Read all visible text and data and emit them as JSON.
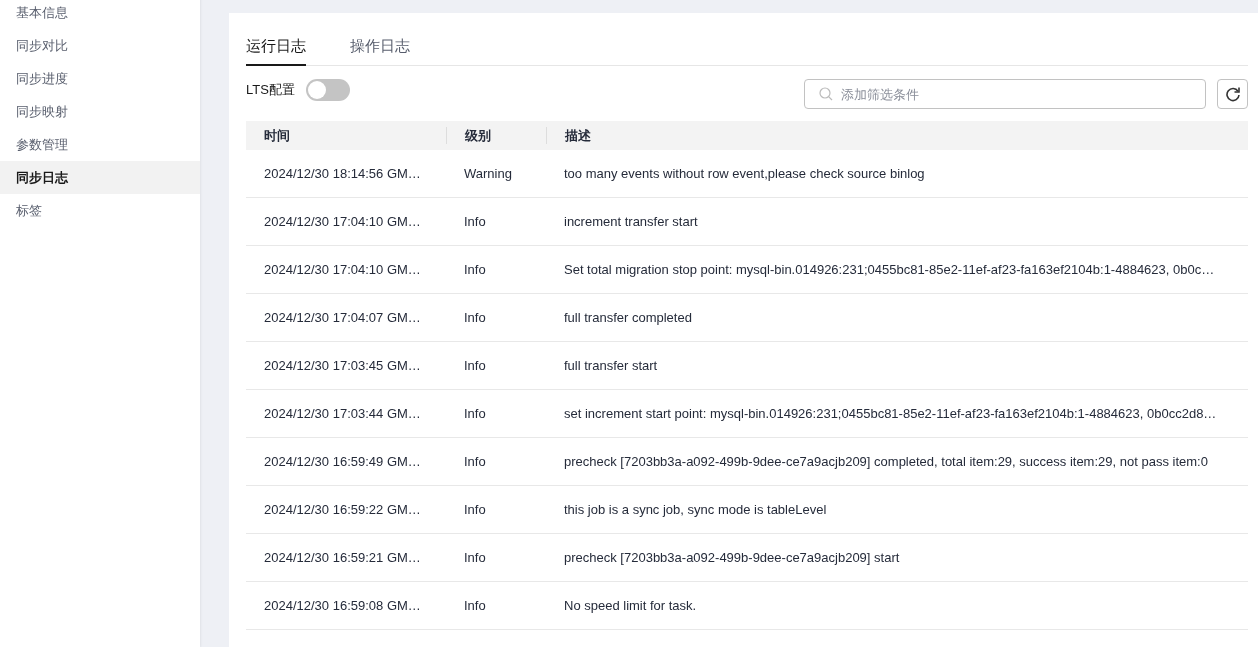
{
  "sidebar": {
    "items": [
      {
        "label": "基本信息",
        "selected": false
      },
      {
        "label": "同步对比",
        "selected": false
      },
      {
        "label": "同步进度",
        "selected": false
      },
      {
        "label": "同步映射",
        "selected": false
      },
      {
        "label": "参数管理",
        "selected": false
      },
      {
        "label": "同步日志",
        "selected": true
      },
      {
        "label": "标签",
        "selected": false
      }
    ]
  },
  "tabs": [
    {
      "label": "运行日志",
      "selected": true
    },
    {
      "label": "操作日志",
      "selected": false
    }
  ],
  "lts_toggle": {
    "label": "LTS配置",
    "on": false
  },
  "search": {
    "placeholder": "添加筛选条件"
  },
  "table": {
    "columns": [
      "时间",
      "级别",
      "描述"
    ],
    "rows": [
      {
        "time": "2024/12/30 18:14:56 GM…",
        "level": "Warning",
        "description": "too many events without row event,please check source binlog"
      },
      {
        "time": "2024/12/30 17:04:10 GM…",
        "level": "Info",
        "description": "increment transfer start"
      },
      {
        "time": "2024/12/30 17:04:10 GM…",
        "level": "Info",
        "description": "Set total migration stop point: mysql-bin.014926:231;0455bc81-85e2-11ef-af23-fa163ef2104b:1-4884623, 0b0c…"
      },
      {
        "time": "2024/12/30 17:04:07 GM…",
        "level": "Info",
        "description": "full transfer completed"
      },
      {
        "time": "2024/12/30 17:03:45 GM…",
        "level": "Info",
        "description": "full transfer start"
      },
      {
        "time": "2024/12/30 17:03:44 GM…",
        "level": "Info",
        "description": "set increment start point: mysql-bin.014926:231;0455bc81-85e2-11ef-af23-fa163ef2104b:1-4884623, 0b0cc2d8…"
      },
      {
        "time": "2024/12/30 16:59:49 GM…",
        "level": "Info",
        "description": "precheck [7203bb3a-a092-499b-9dee-ce7a9acjb209] completed, total item:29, success item:29, not pass item:0"
      },
      {
        "time": "2024/12/30 16:59:22 GM…",
        "level": "Info",
        "description": "this job is a sync job, sync mode is tableLevel"
      },
      {
        "time": "2024/12/30 16:59:21 GM…",
        "level": "Info",
        "description": "precheck [7203bb3a-a092-499b-9dee-ce7a9acjb209] start"
      },
      {
        "time": "2024/12/30 16:59:08 GM…",
        "level": "Info",
        "description": "No speed limit for task."
      }
    ]
  }
}
